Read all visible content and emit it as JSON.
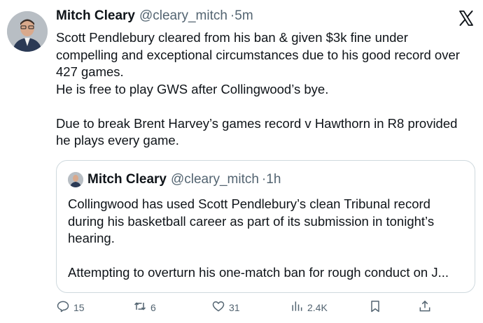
{
  "tweet": {
    "author_name": "Mitch Cleary",
    "handle": "@cleary_mitch",
    "time": "·5m",
    "lines": [
      "Scott Pendlebury cleared from his ban & given $3k fine under",
      "compelling and exceptional circumstances due to his good record over",
      "427 games.",
      "He is free to play GWS after Collingwood’s bye.",
      "",
      "Due to break Brent Harvey’s games record v Hawthorn in R8 provided",
      "he plays every game."
    ]
  },
  "quote": {
    "author_name": "Mitch Cleary",
    "handle": "@cleary_mitch",
    "time": "·1h",
    "lines": [
      "Collingwood has used Scott Pendlebury’s clean Tribunal record",
      "during his basketball career as part of its submission in tonight’s",
      "hearing.",
      "",
      "Attempting to overturn his one-match ban for rough conduct on J..."
    ]
  },
  "actions": {
    "replies": "15",
    "reposts": "6",
    "likes": "31",
    "views": "2.4K"
  },
  "icons": {
    "brand": "x-logo-icon",
    "reply": "reply-icon",
    "repost": "repost-icon",
    "like": "heart-icon",
    "views": "views-icon",
    "bookmark": "bookmark-icon",
    "share": "share-icon"
  }
}
